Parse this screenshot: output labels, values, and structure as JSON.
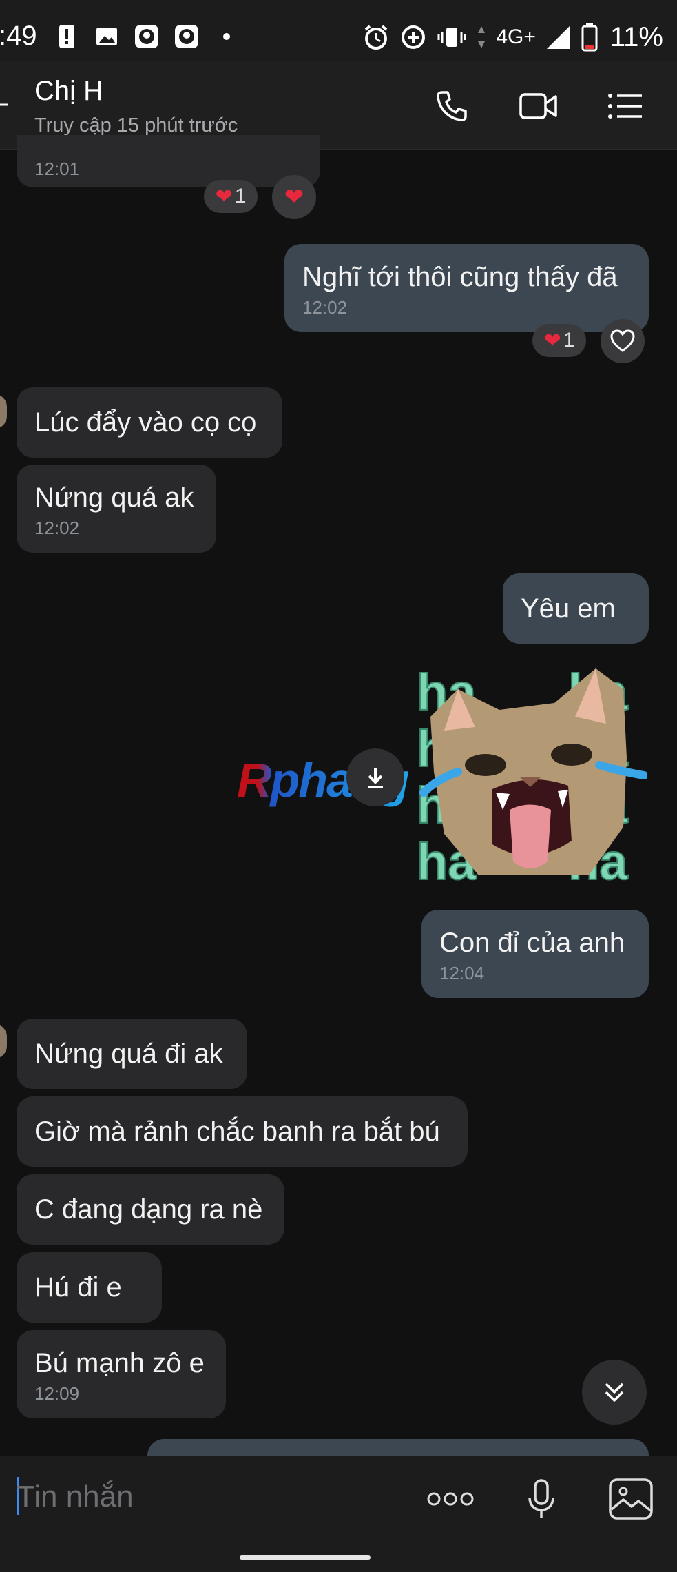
{
  "status_bar": {
    "time": ":49",
    "network": "4G+",
    "battery": "11%"
  },
  "header": {
    "contact_name": "Chị H",
    "status": "Truy cập 15 phút trước"
  },
  "messages": [
    {
      "dir": "in",
      "text": "",
      "time": "12:01"
    },
    {
      "dir": "out",
      "text": "Nghĩ tới thôi cũng thấy đã",
      "time": "12:02"
    },
    {
      "dir": "in",
      "text": "Lúc đẩy vào cọ cọ",
      "time": ""
    },
    {
      "dir": "in",
      "text": "Nứng quá ak",
      "time": "12:02"
    },
    {
      "dir": "out",
      "text": "Yêu em",
      "time": ""
    },
    {
      "dir": "out",
      "text": "Con đỉ của anh",
      "time": "12:04"
    },
    {
      "dir": "in",
      "text": "Nứng quá đi ak",
      "time": ""
    },
    {
      "dir": "in",
      "text": "Giờ mà rảnh chắc banh ra bắt bú",
      "time": ""
    },
    {
      "dir": "in",
      "text": "C đang dạng ra nè",
      "time": ""
    },
    {
      "dir": "in",
      "text": "Hú đi e",
      "time": ""
    },
    {
      "dir": "in",
      "text": "Bú mạnh zô e",
      "time": "12:09"
    }
  ],
  "reactions": {
    "r1_count": "1",
    "r2_count": "1"
  },
  "sticker": {
    "text": "ha"
  },
  "watermark": "Rphang",
  "composer": {
    "placeholder": "Tin nhắn"
  },
  "colors": {
    "background": "#111112",
    "incoming_bubble": "#29292b",
    "outgoing_bubble": "#3d4752",
    "heart": "#e8283c",
    "sticker_text": "#7fd6b3"
  }
}
